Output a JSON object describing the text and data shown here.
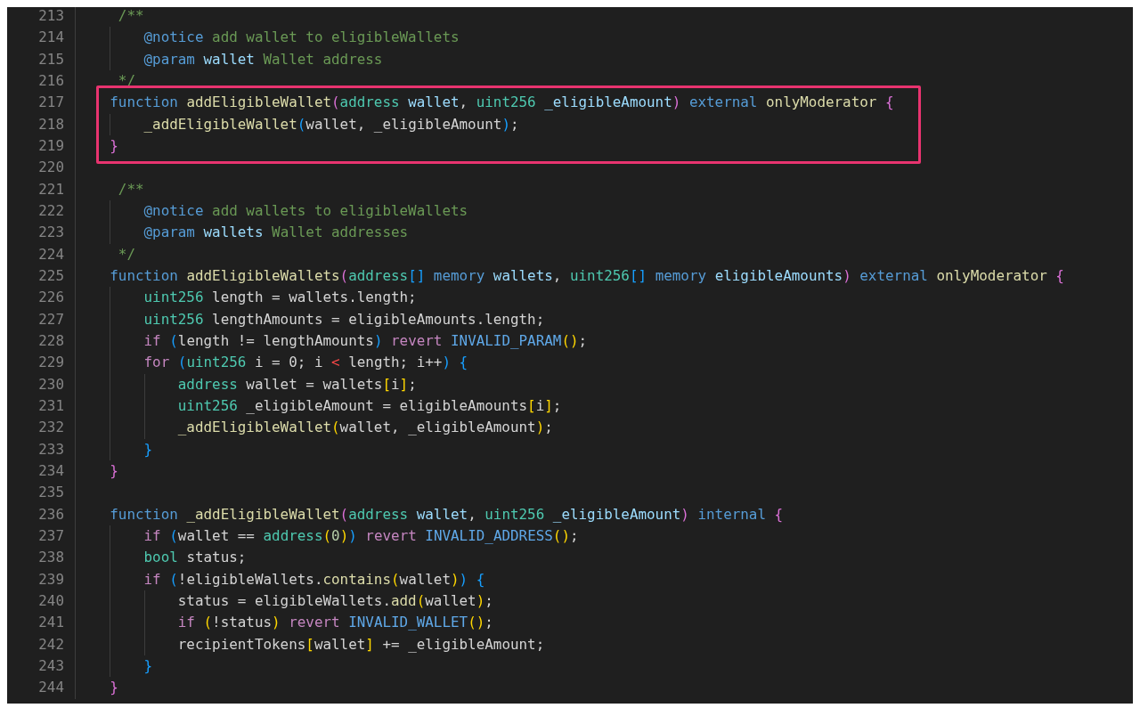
{
  "editor": {
    "lines": [
      {
        "number": "213",
        "highlighted": false,
        "tokens": [
          {
            "kind": "comment",
            "text": "     /**"
          }
        ]
      },
      {
        "number": "214",
        "highlighted": false,
        "tokens": [
          {
            "kind": "doctag",
            "text": "        @notice"
          },
          {
            "kind": "comment",
            "text": " add wallet to eligibleWallets"
          }
        ]
      },
      {
        "number": "215",
        "highlighted": false,
        "tokens": [
          {
            "kind": "doctag",
            "text": "        @param "
          },
          {
            "kind": "param",
            "text": "wallet"
          },
          {
            "kind": "comment",
            "text": " Wallet address"
          }
        ]
      },
      {
        "number": "216",
        "highlighted": false,
        "tokens": [
          {
            "kind": "comment",
            "text": "     */"
          }
        ]
      },
      {
        "number": "217",
        "highlighted": true,
        "tokens": [
          {
            "kind": "keyword",
            "text": "    function "
          },
          {
            "kind": "func",
            "text": "addEligibleWallet"
          },
          {
            "kind": "bracket2",
            "text": "("
          },
          {
            "kind": "type",
            "text": "address "
          },
          {
            "kind": "param",
            "text": "wallet"
          },
          {
            "kind": "plain",
            "text": ", "
          },
          {
            "kind": "type",
            "text": "uint256 "
          },
          {
            "kind": "param",
            "text": "_eligibleAmount"
          },
          {
            "kind": "bracket2",
            "text": ") "
          },
          {
            "kind": "keyword",
            "text": "external "
          },
          {
            "kind": "func",
            "text": "onlyModerator "
          },
          {
            "kind": "bracket2",
            "text": "{"
          }
        ]
      },
      {
        "number": "218",
        "highlighted": true,
        "tokens": [
          {
            "kind": "func",
            "text": "        _addEligibleWallet"
          },
          {
            "kind": "bracket3",
            "text": "("
          },
          {
            "kind": "plain",
            "text": "wallet, _eligibleAmount"
          },
          {
            "kind": "bracket3",
            "text": ")"
          },
          {
            "kind": "plain",
            "text": ";"
          }
        ]
      },
      {
        "number": "219",
        "highlighted": true,
        "tokens": [
          {
            "kind": "bracket2",
            "text": "    }"
          }
        ]
      },
      {
        "number": "220",
        "highlighted": false
      },
      {
        "number": "221",
        "highlighted": false,
        "tokens": [
          {
            "kind": "comment",
            "text": "     /**"
          }
        ]
      },
      {
        "number": "222",
        "highlighted": false,
        "tokens": [
          {
            "kind": "doctag",
            "text": "        @notice"
          },
          {
            "kind": "comment",
            "text": " add wallets to eligibleWallets"
          }
        ]
      },
      {
        "number": "223",
        "highlighted": false,
        "tokens": [
          {
            "kind": "doctag",
            "text": "        @param "
          },
          {
            "kind": "param",
            "text": "wallets"
          },
          {
            "kind": "comment",
            "text": " Wallet addresses"
          }
        ]
      },
      {
        "number": "224",
        "highlighted": false,
        "tokens": [
          {
            "kind": "comment",
            "text": "     */"
          }
        ]
      },
      {
        "number": "225",
        "highlighted": false,
        "tokens": [
          {
            "kind": "keyword",
            "text": "    function "
          },
          {
            "kind": "func",
            "text": "addEligibleWallets"
          },
          {
            "kind": "bracket2",
            "text": "("
          },
          {
            "kind": "type",
            "text": "address"
          },
          {
            "kind": "bracket3",
            "text": "[] "
          },
          {
            "kind": "keyword",
            "text": "memory "
          },
          {
            "kind": "param",
            "text": "wallets"
          },
          {
            "kind": "plain",
            "text": ", "
          },
          {
            "kind": "type",
            "text": "uint256"
          },
          {
            "kind": "bracket3",
            "text": "[] "
          },
          {
            "kind": "keyword",
            "text": "memory "
          },
          {
            "kind": "param",
            "text": "eligibleAmounts"
          },
          {
            "kind": "bracket2",
            "text": ") "
          },
          {
            "kind": "keyword",
            "text": "external "
          },
          {
            "kind": "func",
            "text": "onlyModerator "
          },
          {
            "kind": "bracket2",
            "text": "{"
          }
        ]
      },
      {
        "number": "226",
        "highlighted": false,
        "tokens": [
          {
            "kind": "type",
            "text": "        uint256"
          },
          {
            "kind": "plain",
            "text": " length = wallets.length;"
          }
        ]
      },
      {
        "number": "227",
        "highlighted": false,
        "tokens": [
          {
            "kind": "type",
            "text": "        uint256"
          },
          {
            "kind": "plain",
            "text": " lengthAmounts = eligibleAmounts.length;"
          }
        ]
      },
      {
        "number": "228",
        "highlighted": false,
        "tokens": [
          {
            "kind": "control",
            "text": "        if "
          },
          {
            "kind": "bracket3",
            "text": "("
          },
          {
            "kind": "plain",
            "text": "length != lengthAmounts"
          },
          {
            "kind": "bracket3",
            "text": ") "
          },
          {
            "kind": "control",
            "text": "revert "
          },
          {
            "kind": "error",
            "text": "INVALID_PARAM"
          },
          {
            "kind": "bracket1",
            "text": "()"
          },
          {
            "kind": "plain",
            "text": ";"
          }
        ]
      },
      {
        "number": "229",
        "highlighted": false,
        "tokens": [
          {
            "kind": "control",
            "text": "        for "
          },
          {
            "kind": "bracket3",
            "text": "("
          },
          {
            "kind": "type",
            "text": "uint256"
          },
          {
            "kind": "plain",
            "text": " i = 0; i "
          },
          {
            "kind": "operator",
            "text": "<"
          },
          {
            "kind": "plain",
            "text": " length; i++"
          },
          {
            "kind": "bracket3",
            "text": ") {"
          }
        ]
      },
      {
        "number": "230",
        "highlighted": false,
        "tokens": [
          {
            "kind": "type",
            "text": "            address"
          },
          {
            "kind": "plain",
            "text": " wallet = wallets"
          },
          {
            "kind": "bracket1",
            "text": "["
          },
          {
            "kind": "plain",
            "text": "i"
          },
          {
            "kind": "bracket1",
            "text": "]"
          },
          {
            "kind": "plain",
            "text": ";"
          }
        ]
      },
      {
        "number": "231",
        "highlighted": false,
        "tokens": [
          {
            "kind": "type",
            "text": "            uint256"
          },
          {
            "kind": "plain",
            "text": " _eligibleAmount = eligibleAmounts"
          },
          {
            "kind": "bracket1",
            "text": "["
          },
          {
            "kind": "plain",
            "text": "i"
          },
          {
            "kind": "bracket1",
            "text": "]"
          },
          {
            "kind": "plain",
            "text": ";"
          }
        ]
      },
      {
        "number": "232",
        "highlighted": false,
        "tokens": [
          {
            "kind": "func",
            "text": "            _addEligibleWallet"
          },
          {
            "kind": "bracket1",
            "text": "("
          },
          {
            "kind": "plain",
            "text": "wallet, _eligibleAmount"
          },
          {
            "kind": "bracket1",
            "text": ")"
          },
          {
            "kind": "plain",
            "text": ";"
          }
        ]
      },
      {
        "number": "233",
        "highlighted": false,
        "tokens": [
          {
            "kind": "bracket3",
            "text": "        }"
          }
        ]
      },
      {
        "number": "234",
        "highlighted": false,
        "tokens": [
          {
            "kind": "bracket2",
            "text": "    }"
          }
        ]
      },
      {
        "number": "235",
        "highlighted": false
      },
      {
        "number": "236",
        "highlighted": false,
        "tokens": [
          {
            "kind": "keyword",
            "text": "    function "
          },
          {
            "kind": "func",
            "text": "_addEligibleWallet"
          },
          {
            "kind": "bracket2",
            "text": "("
          },
          {
            "kind": "type",
            "text": "address "
          },
          {
            "kind": "param",
            "text": "wallet"
          },
          {
            "kind": "plain",
            "text": ", "
          },
          {
            "kind": "type",
            "text": "uint256 "
          },
          {
            "kind": "param",
            "text": "_eligibleAmount"
          },
          {
            "kind": "bracket2",
            "text": ") "
          },
          {
            "kind": "keyword",
            "text": "internal "
          },
          {
            "kind": "bracket2",
            "text": "{"
          }
        ]
      },
      {
        "number": "237",
        "highlighted": false,
        "tokens": [
          {
            "kind": "control",
            "text": "        if "
          },
          {
            "kind": "bracket3",
            "text": "("
          },
          {
            "kind": "plain",
            "text": "wallet == "
          },
          {
            "kind": "type",
            "text": "address"
          },
          {
            "kind": "bracket1",
            "text": "("
          },
          {
            "kind": "number",
            "text": "0"
          },
          {
            "kind": "bracket1",
            "text": ")"
          },
          {
            "kind": "bracket3",
            "text": ") "
          },
          {
            "kind": "control",
            "text": "revert "
          },
          {
            "kind": "error",
            "text": "INVALID_ADDRESS"
          },
          {
            "kind": "bracket1",
            "text": "()"
          },
          {
            "kind": "plain",
            "text": ";"
          }
        ]
      },
      {
        "number": "238",
        "highlighted": false,
        "tokens": [
          {
            "kind": "type",
            "text": "        bool"
          },
          {
            "kind": "plain",
            "text": " status;"
          }
        ]
      },
      {
        "number": "239",
        "highlighted": false,
        "tokens": [
          {
            "kind": "control",
            "text": "        if "
          },
          {
            "kind": "bracket3",
            "text": "("
          },
          {
            "kind": "plain",
            "text": "!eligibleWallets."
          },
          {
            "kind": "func",
            "text": "contains"
          },
          {
            "kind": "bracket1",
            "text": "("
          },
          {
            "kind": "plain",
            "text": "wallet"
          },
          {
            "kind": "bracket1",
            "text": ")"
          },
          {
            "kind": "bracket3",
            "text": ") {"
          }
        ]
      },
      {
        "number": "240",
        "highlighted": false,
        "tokens": [
          {
            "kind": "plain",
            "text": "            status = eligibleWallets."
          },
          {
            "kind": "func",
            "text": "add"
          },
          {
            "kind": "bracket1",
            "text": "("
          },
          {
            "kind": "plain",
            "text": "wallet"
          },
          {
            "kind": "bracket1",
            "text": ")"
          },
          {
            "kind": "plain",
            "text": ";"
          }
        ]
      },
      {
        "number": "241",
        "highlighted": false,
        "tokens": [
          {
            "kind": "control",
            "text": "            if "
          },
          {
            "kind": "bracket1",
            "text": "("
          },
          {
            "kind": "plain",
            "text": "!status"
          },
          {
            "kind": "bracket1",
            "text": ") "
          },
          {
            "kind": "control",
            "text": "revert "
          },
          {
            "kind": "error",
            "text": "INVALID_WALLET"
          },
          {
            "kind": "bracket1",
            "text": "()"
          },
          {
            "kind": "plain",
            "text": ";"
          }
        ]
      },
      {
        "number": "242",
        "highlighted": false,
        "tokens": [
          {
            "kind": "plain",
            "text": "            recipientTokens"
          },
          {
            "kind": "bracket1",
            "text": "["
          },
          {
            "kind": "plain",
            "text": "wallet"
          },
          {
            "kind": "bracket1",
            "text": "]"
          },
          {
            "kind": "plain",
            "text": " += _eligibleAmount;"
          }
        ]
      },
      {
        "number": "243",
        "highlighted": false,
        "tokens": [
          {
            "kind": "bracket3",
            "text": "        }"
          }
        ]
      },
      {
        "number": "244",
        "highlighted": false,
        "tokens": [
          {
            "kind": "bracket2",
            "text": "    }"
          }
        ]
      }
    ]
  }
}
